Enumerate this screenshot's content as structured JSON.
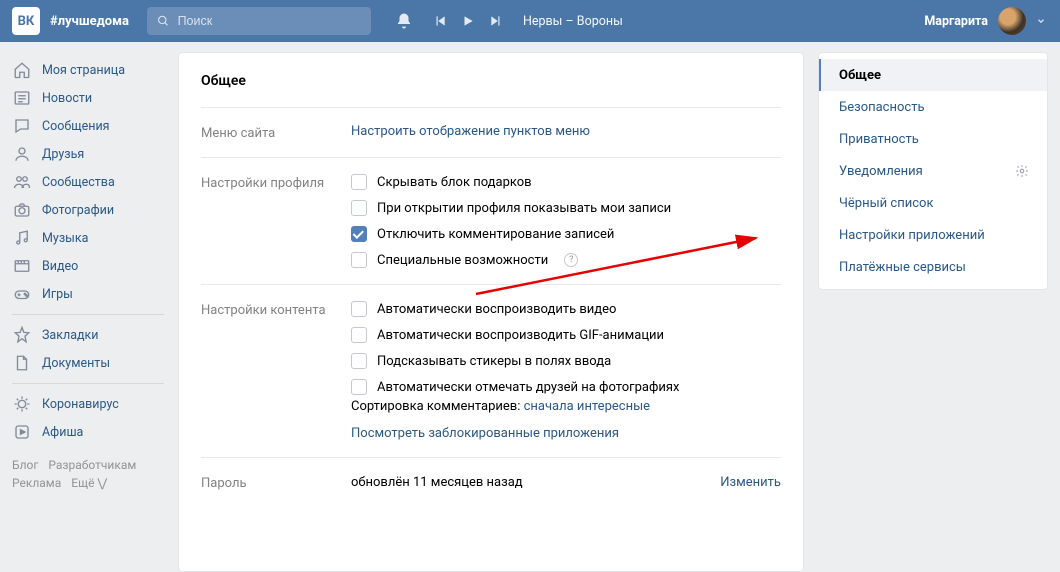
{
  "header": {
    "logo_text": "ВК",
    "hashtag": "#лучшедома",
    "search_placeholder": "Поиск",
    "track": "Нервы – Вороны",
    "username": "Маргарита"
  },
  "leftnav": {
    "items": [
      {
        "label": "Моя страница",
        "icon": "home"
      },
      {
        "label": "Новости",
        "icon": "news"
      },
      {
        "label": "Сообщения",
        "icon": "chat"
      },
      {
        "label": "Друзья",
        "icon": "user"
      },
      {
        "label": "Сообщества",
        "icon": "users"
      },
      {
        "label": "Фотографии",
        "icon": "camera"
      },
      {
        "label": "Музыка",
        "icon": "music"
      },
      {
        "label": "Видео",
        "icon": "video"
      },
      {
        "label": "Игры",
        "icon": "game"
      }
    ],
    "items2": [
      {
        "label": "Закладки",
        "icon": "star"
      },
      {
        "label": "Документы",
        "icon": "doc"
      }
    ],
    "items3": [
      {
        "label": "Коронавирус",
        "icon": "virus"
      },
      {
        "label": "Афиша",
        "icon": "play"
      }
    ],
    "footer": {
      "blog": "Блог",
      "dev": "Разработчикам",
      "ads": "Реклама",
      "more": "Ещё ⋁"
    }
  },
  "main": {
    "title": "Общее",
    "menu_label": "Меню сайта",
    "menu_link": "Настроить отображение пунктов меню",
    "profile_label": "Настройки профиля",
    "profile_checks": [
      {
        "label": "Скрывать блок подарков",
        "checked": false
      },
      {
        "label": "При открытии профиля показывать мои записи",
        "checked": false
      },
      {
        "label": "Отключить комментирование записей",
        "checked": true
      },
      {
        "label": "Специальные возможности",
        "checked": false,
        "help": true
      }
    ],
    "content_label": "Настройки контента",
    "content_checks": [
      {
        "label": "Автоматически воспроизводить видео",
        "checked": false
      },
      {
        "label": "Автоматически воспроизводить GIF-анимации",
        "checked": false
      },
      {
        "label": "Подсказывать стикеры в полях ввода",
        "checked": false
      },
      {
        "label": "Автоматически отмечать друзей на фотографиях",
        "checked": false
      }
    ],
    "sort_prefix": "Сортировка комментариев: ",
    "sort_link": "сначала интересные",
    "blocked_link": "Посмотреть заблокированные приложения",
    "pw_label": "Пароль",
    "pw_value": "обновлён 11 месяцев назад",
    "pw_change": "Изменить"
  },
  "rightnav": {
    "items": [
      {
        "label": "Общее",
        "active": true
      },
      {
        "label": "Безопасность"
      },
      {
        "label": "Приватность"
      },
      {
        "label": "Уведомления",
        "gear": true
      },
      {
        "label": "Чёрный список"
      },
      {
        "label": "Настройки приложений"
      },
      {
        "label": "Платёжные сервисы"
      }
    ]
  }
}
